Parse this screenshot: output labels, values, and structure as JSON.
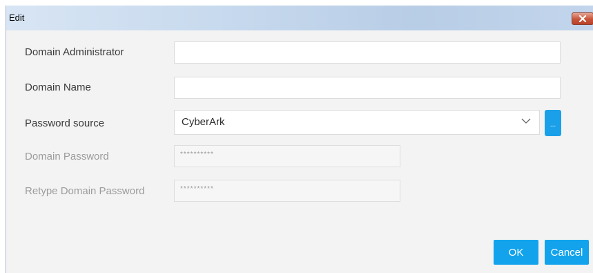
{
  "dialog": {
    "title": "Edit",
    "close_icon": "close-icon"
  },
  "form": {
    "domain_admin_label": "Domain Administrator",
    "domain_admin_value": "",
    "domain_name_label": "Domain Name",
    "domain_name_value": "",
    "password_source_label": "Password source",
    "password_source_value": "CyberArk",
    "browse_label": "...",
    "domain_password_label": "Domain Password",
    "domain_password_value": "**********",
    "retype_password_label": "Retype Domain Password",
    "retype_password_value": "**********"
  },
  "buttons": {
    "ok": "OK",
    "cancel": "Cancel"
  },
  "colors": {
    "accent": "#12a3ec",
    "close": "#c6543a"
  }
}
